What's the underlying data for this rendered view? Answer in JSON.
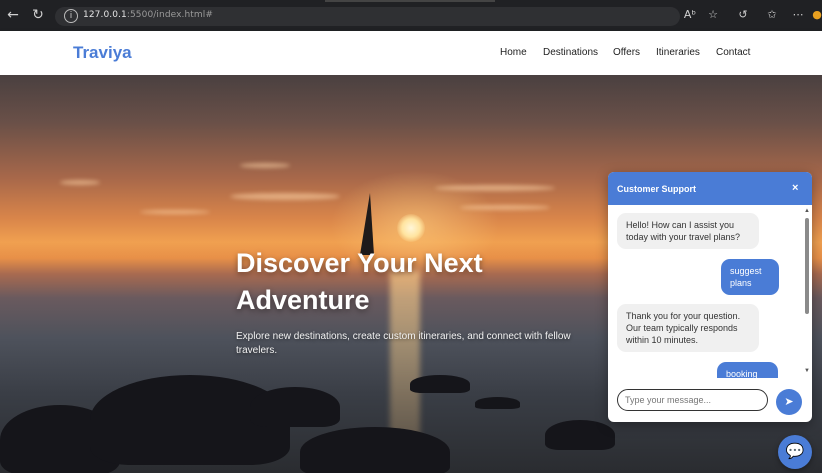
{
  "browser": {
    "url_host": "127.0.0.1",
    "url_rest": ":5500/index.html#",
    "icons": [
      "back-arrow-icon",
      "reload-icon",
      "info-icon",
      "read-aloud-icon",
      "favorite-star-icon",
      "copilot-icon",
      "favorites-icon",
      "more-icon"
    ]
  },
  "header": {
    "logo": "Traviya",
    "nav": [
      "Home",
      "Destinations",
      "Offers",
      "Itineraries",
      "Contact"
    ]
  },
  "hero": {
    "title_line1": "Discover Your Next",
    "title_line2": "Adventure",
    "subtitle": "Explore new destinations, create custom itineraries, and connect with fellow travelers."
  },
  "chat": {
    "title": "Customer Support",
    "close": "×",
    "messages": [
      {
        "from": "bot",
        "text": "Hello! How can I assist you today with your travel plans?"
      },
      {
        "from": "user",
        "text": "suggest plans"
      },
      {
        "from": "bot",
        "text": "Thank you for your question. Our team typically responds within 10 minutes."
      },
      {
        "from": "user",
        "text": "booking"
      }
    ],
    "input_placeholder": "Type your message..."
  },
  "colors": {
    "accent": "#4a7cd6"
  }
}
